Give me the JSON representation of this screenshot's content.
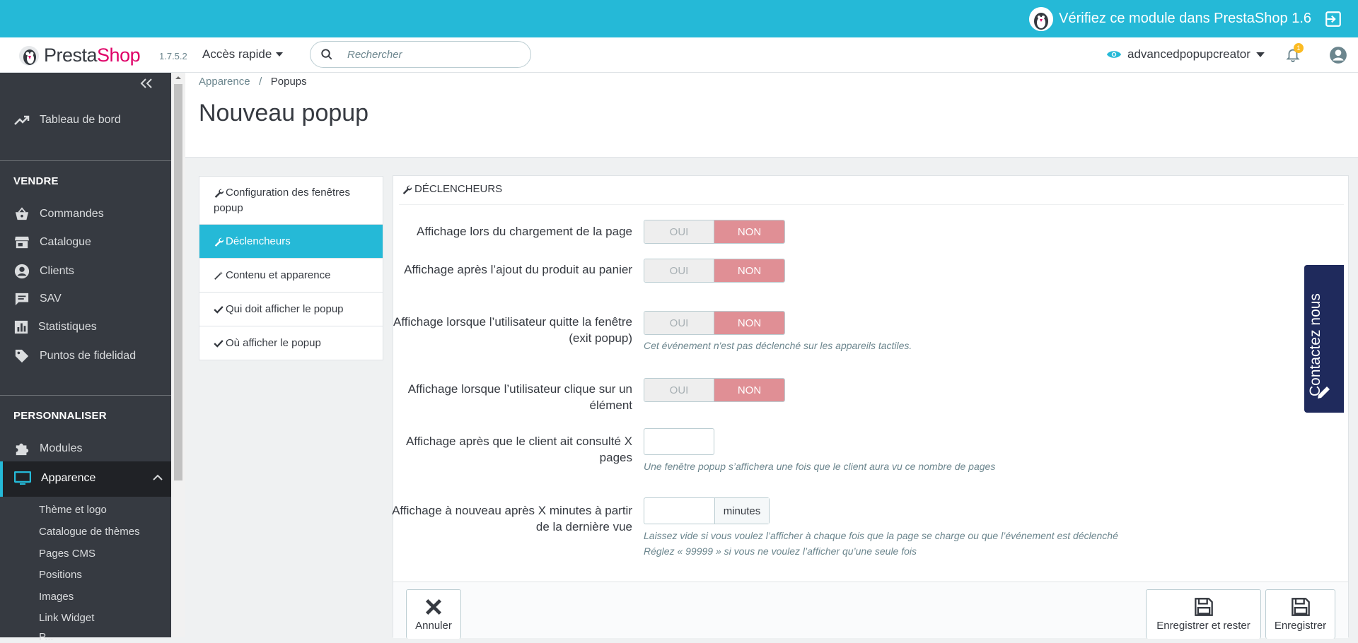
{
  "banner": {
    "text": "Vérifiez ce module dans PrestaShop 1.6"
  },
  "header": {
    "logo_a": "Presta",
    "logo_b": "Shop",
    "version": "1.7.5.2",
    "quick_access": "Accès rapide",
    "search_placeholder": "Rechercher",
    "user": "advancedpopupcreator",
    "notifications": "1"
  },
  "sidebar": {
    "dashboard": "Tableau de bord",
    "section_sell": "VENDRE",
    "sell_items": [
      "Commandes",
      "Catalogue",
      "Clients",
      "SAV",
      "Statistiques",
      "Puntos de fidelidad"
    ],
    "section_custom": "PERSONNALISER",
    "modules": "Modules",
    "appearance": "Apparence",
    "appearance_subitems": [
      "Thème et logo",
      "Catalogue de thèmes",
      "Pages CMS",
      "Positions",
      "Images",
      "Link Widget",
      "P..."
    ]
  },
  "page": {
    "breadcrumb_parent": "Apparence",
    "breadcrumb_sep": "/",
    "breadcrumb_current": "Popups",
    "title": "Nouveau popup"
  },
  "tabs": [
    "Configuration des fenêtres popup",
    "Déclencheurs",
    "Contenu et apparence",
    "Qui doit afficher le popup",
    "Où afficher le popup"
  ],
  "panel": {
    "title": "Déclencheurs",
    "yes": "OUI",
    "no": "NON",
    "fields": {
      "load": "Affichage lors du chargement de la page",
      "cart": "Affichage après l’ajout du produit au panier",
      "exit": "Affichage lorsque l’utilisateur quitte la fenêtre (exit popup)",
      "exit_help": "Cet événement n'est pas déclenché sur les appareils tactiles.",
      "click": "Affichage lorsque l’utilisateur clique sur un élément",
      "pages": "Affichage après que le client ait consulté X pages",
      "pages_help": "Une fenêtre popup s’affichera une fois que le client aura vu ce nombre de pages",
      "minutes": "Affichage à nouveau après X minutes à partir de la dernière vue",
      "minutes_addon": "minutes",
      "minutes_help1": "Laissez vide si vous voulez l’afficher à chaque fois que la page se charge ou que l’événement est déclenché",
      "minutes_help2": "Réglez « 99999 » si vous ne voulez l’afficher qu’une seule fois"
    },
    "buttons": {
      "cancel": "Annuler",
      "save_stay": "Enregistrer et rester",
      "save": "Enregistrer"
    }
  },
  "contact": {
    "label": "Contactez nous"
  },
  "colors": {
    "accent": "#25b9d7",
    "sidebar": "#363a41",
    "toggle_off": "#e08f95",
    "contact": "#1f2a5c"
  }
}
